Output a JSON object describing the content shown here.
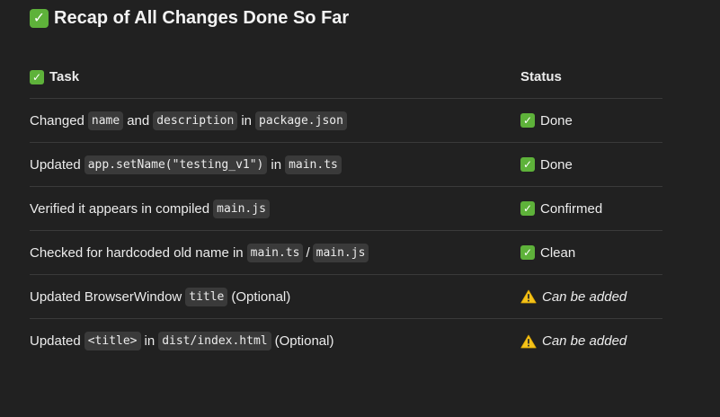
{
  "heading": {
    "icon": "check-mark-emoji-icon",
    "text": "Recap of All Changes Done So Far"
  },
  "table": {
    "headers": {
      "task": "Task",
      "status": "Status"
    },
    "rows": [
      {
        "parts": [
          "Changed",
          "name",
          "and",
          "description",
          "in",
          "package.json"
        ],
        "status_icon": "check-mark-emoji-icon",
        "status": "Done"
      },
      {
        "parts": [
          "Updated",
          "app.setName(\"testing_v1\")",
          "in",
          "main.ts"
        ],
        "status_icon": "check-mark-emoji-icon",
        "status": "Done"
      },
      {
        "parts": [
          "Verified it appears in compiled",
          "main.js"
        ],
        "status_icon": "check-mark-emoji-icon",
        "status": "Confirmed"
      },
      {
        "parts": [
          "Checked for hardcoded old name in",
          "main.ts",
          "/",
          "main.js"
        ],
        "status_icon": "check-mark-emoji-icon",
        "status": "Clean"
      },
      {
        "parts": [
          "Updated BrowserWindow",
          "title",
          "(Optional)"
        ],
        "status_icon": "warning-emoji-icon",
        "status": "Can be added"
      },
      {
        "parts": [
          "Updated",
          "<title>",
          "in",
          "dist/index.html",
          "(Optional)"
        ],
        "status_icon": "warning-emoji-icon",
        "status": "Can be added"
      }
    ]
  },
  "colors": {
    "background": "#212121",
    "text": "#ececec",
    "code_background": "#3a3a3a",
    "divider": "#3a3a3a",
    "check_green": "#5eb23a",
    "warning_yellow": "#f4c21a"
  }
}
